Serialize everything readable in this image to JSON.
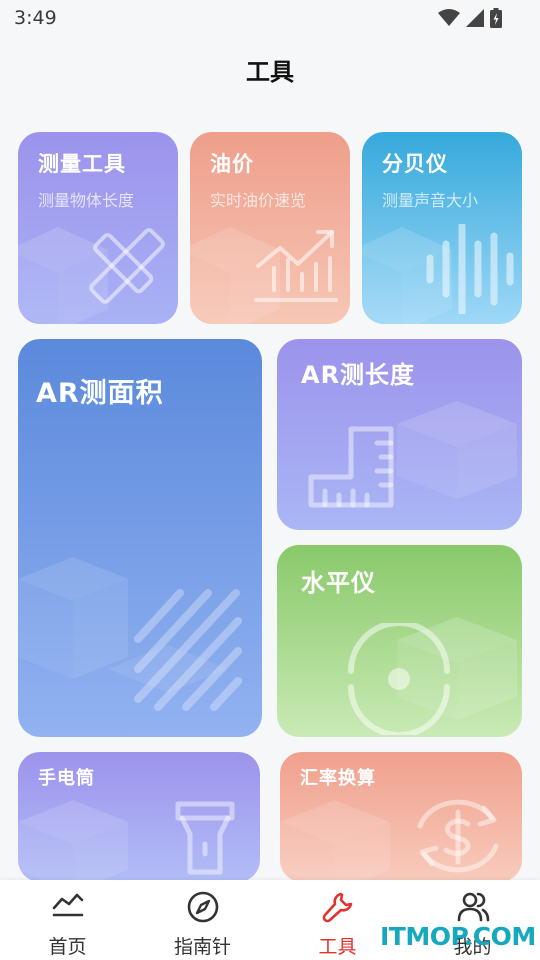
{
  "status_bar": {
    "time": "3:49"
  },
  "header": {
    "title": "工具"
  },
  "cards": {
    "measure": {
      "title": "测量工具",
      "subtitle": "测量物体长度"
    },
    "oil": {
      "title": "油价",
      "subtitle": "实时油价速览"
    },
    "decibel": {
      "title": "分贝仪",
      "subtitle": "测量声音大小"
    },
    "ar_area": {
      "title": "AR测面积"
    },
    "ar_length": {
      "title": "AR测长度"
    },
    "level": {
      "title": "水平仪"
    },
    "flashlight": {
      "title": "手电筒"
    },
    "exchange": {
      "title": "汇率换算"
    }
  },
  "tabbar": {
    "items": [
      {
        "label": "首页",
        "icon": "home-chart-icon"
      },
      {
        "label": "指南针",
        "icon": "compass-icon"
      },
      {
        "label": "工具",
        "icon": "wrench-icon",
        "active": true
      },
      {
        "label": "我的",
        "icon": "users-icon"
      }
    ],
    "active_color": "#e3322d"
  },
  "watermark": "ITMOP.COM"
}
